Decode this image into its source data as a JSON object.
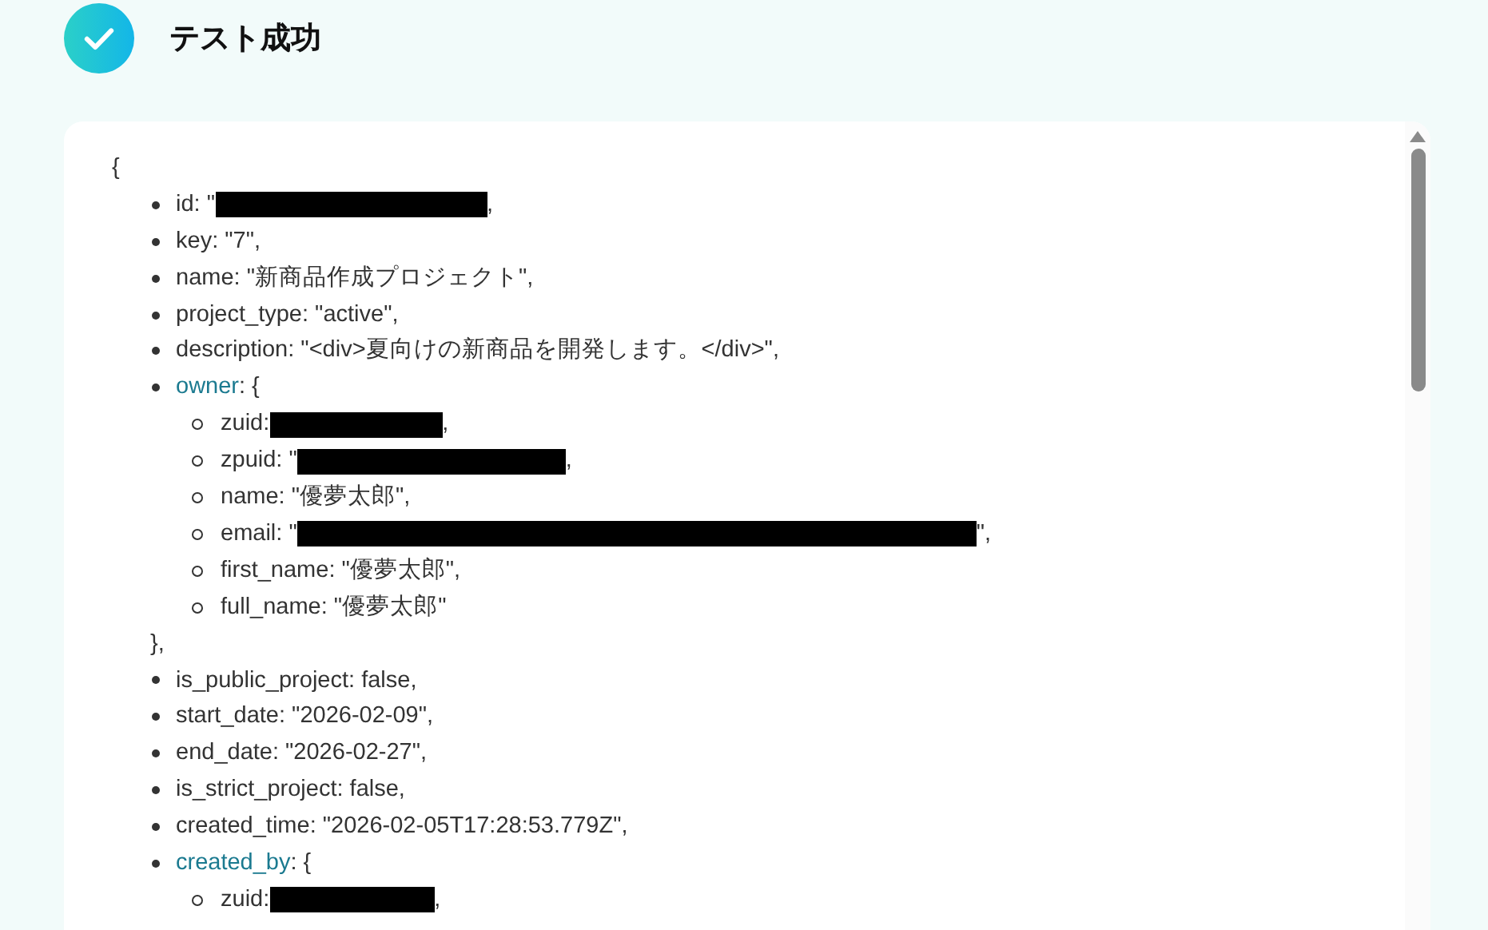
{
  "header": {
    "title": "テスト成功"
  },
  "json_view": {
    "open": "{",
    "items": [
      {
        "key": "id",
        "text": ": \"",
        "redacted": true,
        "after": ","
      },
      {
        "key": "key",
        "text": ": \"7\","
      },
      {
        "key": "name",
        "text": ": \"新商品作成プロジェクト\","
      },
      {
        "key": "project_type",
        "text": ": \"active\","
      },
      {
        "key": "description",
        "text": ": \"<div>夏向けの新商品を開発します。</div>\","
      },
      {
        "key": "owner",
        "kind": "object",
        "text": ": {",
        "close": "},",
        "children": [
          {
            "key": "zuid",
            "text": ": ",
            "redacted": true,
            "after": ","
          },
          {
            "key": "zpuid",
            "text": ": \"",
            "redacted": true,
            "after": ","
          },
          {
            "key": "name",
            "text": ": \"優夢太郎\","
          },
          {
            "key": "email",
            "text": ": \"",
            "redacted": true,
            "after": "\","
          },
          {
            "key": "first_name",
            "text": ": \"優夢太郎\","
          },
          {
            "key": "full_name",
            "text": ": \"優夢太郎\""
          }
        ]
      },
      {
        "key": "is_public_project",
        "text": ": false,"
      },
      {
        "key": "start_date",
        "text": ": \"2026-02-09\","
      },
      {
        "key": "end_date",
        "text": ": \"2026-02-27\","
      },
      {
        "key": "is_strict_project",
        "text": ": false,"
      },
      {
        "key": "created_time",
        "text": ": \"2026-02-05T17:28:53.779Z\","
      },
      {
        "key": "created_by",
        "kind": "object",
        "text": ": {",
        "children": [
          {
            "key": "zuid",
            "text": ": ",
            "redacted": true,
            "after": ","
          }
        ]
      }
    ]
  }
}
